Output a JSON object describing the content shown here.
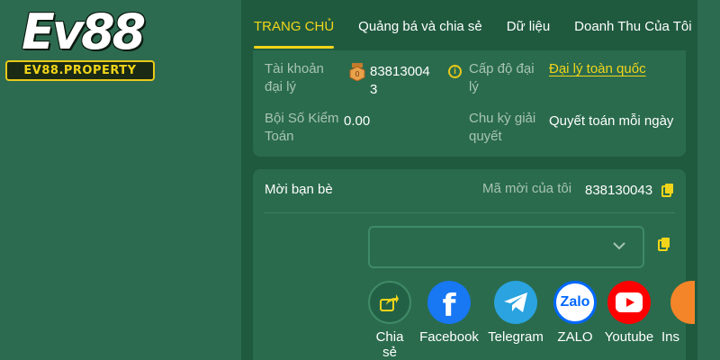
{
  "logo": {
    "main": "Ev88",
    "sub": "EV88.PROPERTY"
  },
  "nav": {
    "tabs": [
      {
        "label": "TRANG CHỦ",
        "active": true
      },
      {
        "label": "Quảng bá và chia sẻ",
        "active": false
      },
      {
        "label": "Dữ liệu",
        "active": false
      },
      {
        "label": "Doanh Thu Của Tôi",
        "active": false
      }
    ]
  },
  "agent_info": {
    "account_label_1": "Tài khoản",
    "account_label_2": "đại lý",
    "account_value_1": "83813004",
    "account_value_2": "3",
    "level_label_1": "Cấp độ đại",
    "level_label_2": "lý",
    "level_value": "Đại lý toàn quốc",
    "multiplier_label_1": "Bội Số Kiểm",
    "multiplier_label_2": "Toán",
    "multiplier_value": "0.00",
    "cycle_label_1": "Chu kỳ giải",
    "cycle_label_2": "quyết",
    "cycle_value": "Quyết toán mỗi ngày"
  },
  "invite": {
    "title": "Mời bạn bè",
    "code_label": "Mã mời của tôi",
    "code_value": "838130043",
    "share_items": [
      {
        "label_1": "Chia",
        "label_2": "sẻ",
        "icon": "share-icon"
      },
      {
        "label_1": "Facebook",
        "label_2": "",
        "icon": "facebook-icon"
      },
      {
        "label_1": "Telegram",
        "label_2": "",
        "icon": "telegram-icon"
      },
      {
        "label_1": "ZALO",
        "label_2": "",
        "icon": "zalo-icon"
      },
      {
        "label_1": "Youtube",
        "label_2": "",
        "icon": "youtube-icon"
      },
      {
        "label_1": "Ins",
        "label_2": "",
        "icon": "instagram-icon"
      }
    ],
    "zalo_text": "Zalo"
  },
  "colors": {
    "accent": "#f2d51a",
    "background": "#2d6b50",
    "panel": "#1f5a3f",
    "card": "#2a6b4d"
  }
}
